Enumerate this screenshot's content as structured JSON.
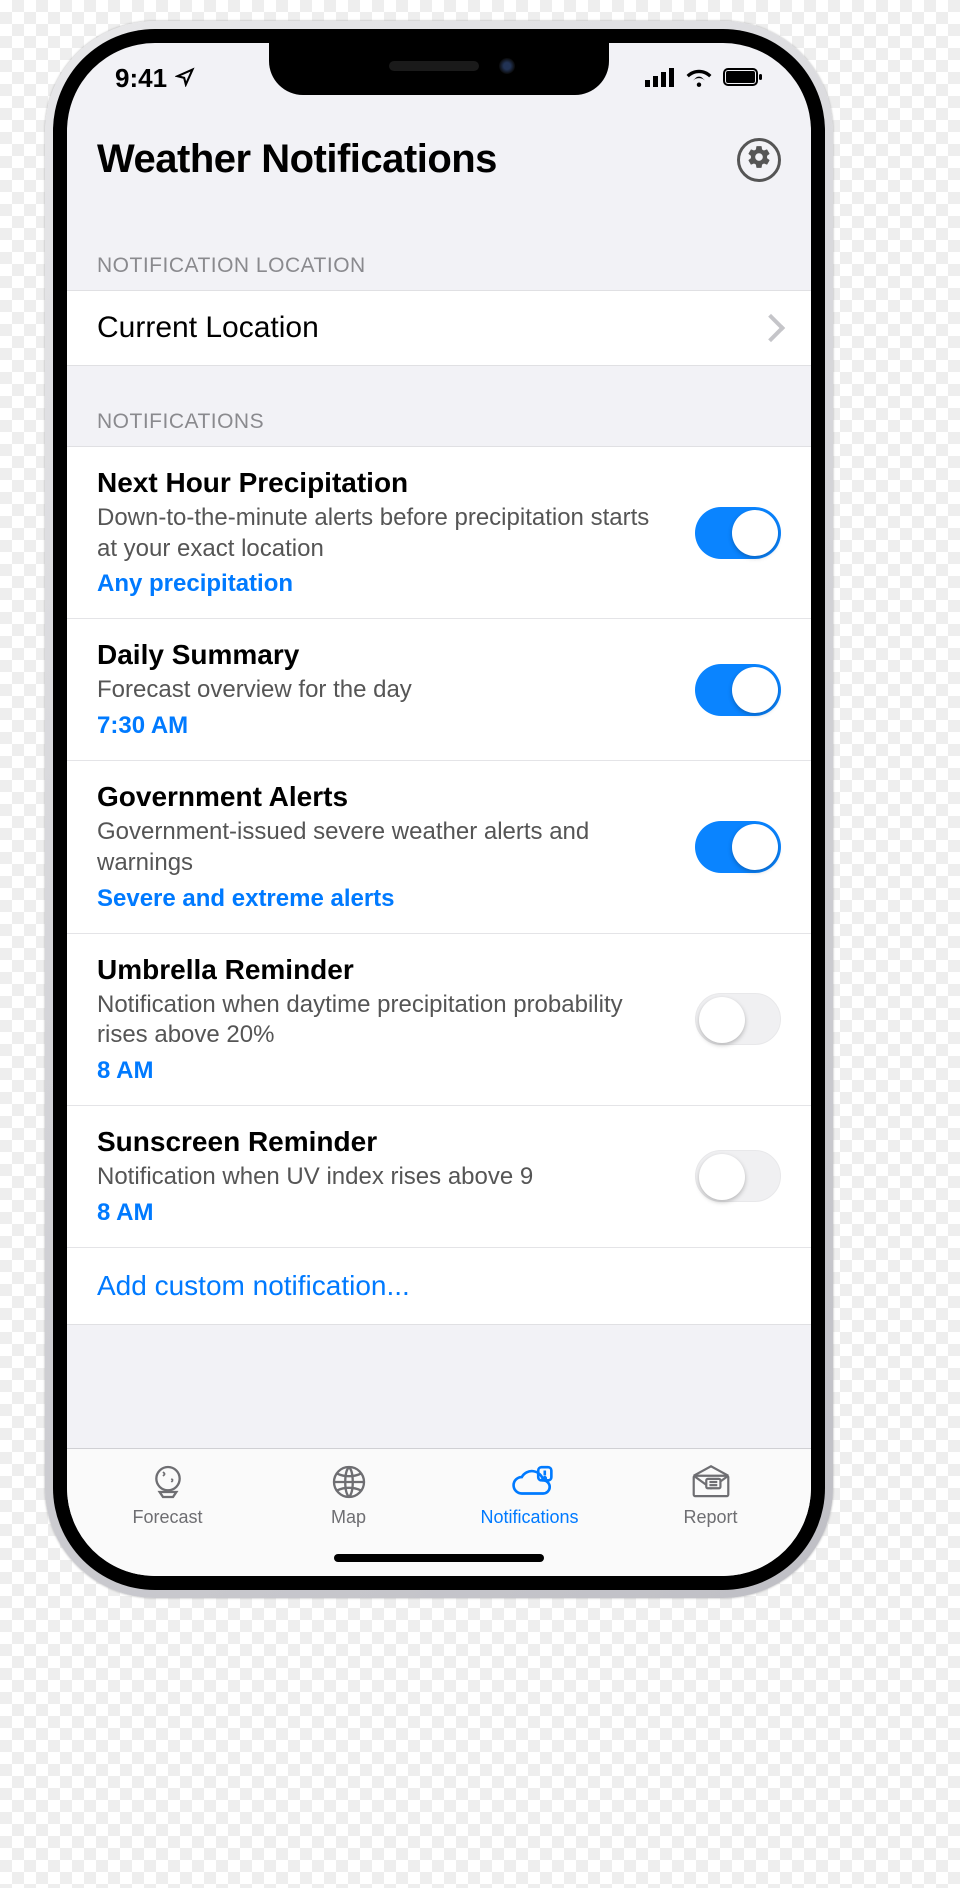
{
  "status_bar": {
    "time": "9:41"
  },
  "header": {
    "title": "Weather Notifications"
  },
  "sections": {
    "location_header": "NOTIFICATION LOCATION",
    "location_value": "Current Location",
    "notifications_header": "NOTIFICATIONS"
  },
  "notifications": {
    "next_hour": {
      "title": "Next Hour Precipitation",
      "desc": "Down-to-the-minute alerts before precipitation starts at your exact location",
      "link": "Any precipitation",
      "on": true
    },
    "daily": {
      "title": "Daily Summary",
      "desc": "Forecast overview for the day",
      "link": "7:30 AM",
      "on": true
    },
    "gov": {
      "title": "Government Alerts",
      "desc": "Government-issued severe weather alerts and warnings",
      "link": "Severe and extreme alerts",
      "on": true
    },
    "umbrella": {
      "title": "Umbrella Reminder",
      "desc": "Notification when daytime precipitation probability rises above 20%",
      "link": "8 AM",
      "on": false
    },
    "sunscreen": {
      "title": "Sunscreen Reminder",
      "desc": "Notification when UV index rises above 9",
      "link": "8 AM",
      "on": false
    },
    "add": "Add custom notification..."
  },
  "tabs": {
    "forecast": "Forecast",
    "map": "Map",
    "notifications": "Notifications",
    "report": "Report",
    "active": "notifications"
  }
}
